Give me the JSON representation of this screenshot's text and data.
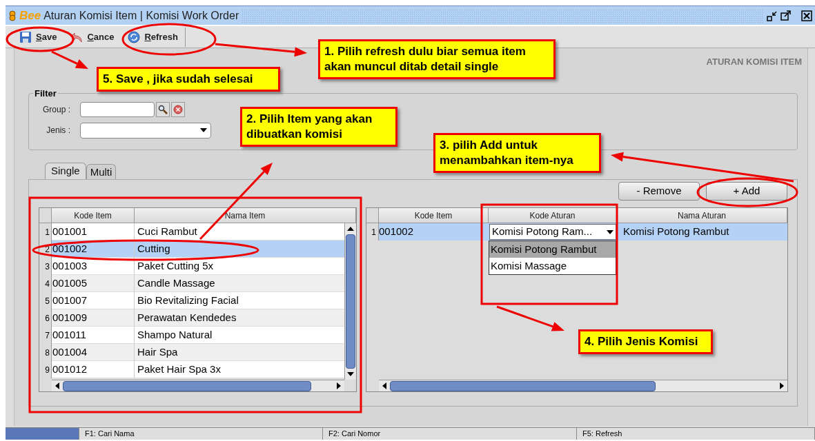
{
  "window": {
    "logo": "Bee",
    "title": "Aturan Komisi Item | Komisi Work Order"
  },
  "toolbar": [
    {
      "kind": "save",
      "label": "Save"
    },
    {
      "kind": "cancel",
      "label": "Cance"
    },
    {
      "kind": "refresh",
      "label": "Refresh"
    }
  ],
  "form_title": "ATURAN KOMISI ITEM",
  "filter": {
    "legend": "Filter",
    "fields": [
      {
        "kind": "lookup",
        "label": "Group :"
      },
      {
        "kind": "select",
        "label": "Jenis :"
      }
    ]
  },
  "tabs": [
    {
      "label": "Single",
      "selected": true
    },
    {
      "label": "Multi",
      "selected": false
    }
  ],
  "actions": [
    "- Remove",
    "+ Add"
  ],
  "item_table": {
    "columns": [
      "Kode Item",
      "Nama Item"
    ],
    "rows": [
      {
        "number": "1",
        "kode": "001001",
        "nama": "Cuci Rambut",
        "selected": false
      },
      {
        "number": "2",
        "kode": "001002",
        "nama": "Cutting",
        "selected": true
      },
      {
        "number": "3",
        "kode": "001003",
        "nama": "Paket Cutting 5x",
        "selected": false
      },
      {
        "number": "4",
        "kode": "001005",
        "nama": "Candle Massage",
        "selected": false
      },
      {
        "number": "5",
        "kode": "001007",
        "nama": "Bio  Revitalizing Facial",
        "selected": false
      },
      {
        "number": "6",
        "kode": "001009",
        "nama": "Perawatan Kendedes",
        "selected": false
      },
      {
        "number": "7",
        "kode": "001011",
        "nama": "Shampo Natural",
        "selected": false
      },
      {
        "number": "8",
        "kode": "001004",
        "nama": "Hair Spa",
        "selected": false
      },
      {
        "number": "9",
        "kode": "001012",
        "nama": "Paket Hair Spa 3x",
        "selected": false
      }
    ]
  },
  "rule_table": {
    "columns": [
      "Kode Item",
      "Kode Aturan",
      "Nama Aturan"
    ],
    "rows": [
      {
        "number": "1",
        "kode_item": "001002",
        "kode_aturan": "Komisi Potong Ram...",
        "nama_aturan": "Komisi Potong Rambut",
        "selected": true
      }
    ],
    "dropdown_options": [
      {
        "label": "Komisi Potong Rambut",
        "selected": true
      },
      {
        "label": "Komisi Massage",
        "selected": false
      }
    ]
  },
  "callouts": [
    "1. Pilih refresh dulu biar semua item akan muncul ditab detail single",
    "5. Save , jika sudah selesai",
    "2. Pilih Item yang akan dibuatkan komisi",
    "3. pilih Add untuk menambahkan item-nya",
    "4. Pilih Jenis Komisi"
  ],
  "status_bar": [
    "F1: Cari Nama",
    "F2: Cari Nomor",
    "F5: Refresh"
  ]
}
